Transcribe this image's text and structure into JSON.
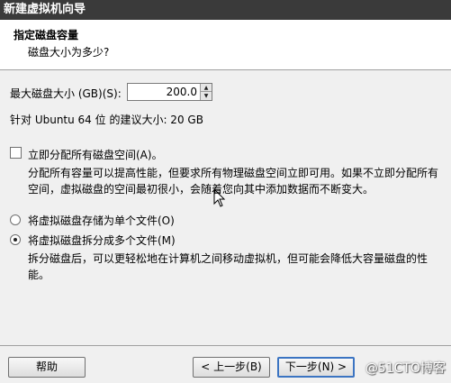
{
  "window": {
    "title": "新建虚拟机向导"
  },
  "header": {
    "title": "指定磁盘容量",
    "subtitle": "磁盘大小为多少?"
  },
  "disk": {
    "size_label": "最大磁盘大小 (GB)(S):",
    "size_value": "200.0",
    "recommend": "针对 Ubuntu 64 位 的建议大小: 20 GB"
  },
  "allocate": {
    "label": "立即分配所有磁盘空间(A)。",
    "checked": false,
    "description": "分配所有容量可以提高性能，但要求所有物理磁盘空间立即可用。如果不立即分配所有空间，虚拟磁盘的空间最初很小，会随着您向其中添加数据而不断变大。"
  },
  "storage": {
    "single_label": "将虚拟磁盘存储为单个文件(O)",
    "split_label": "将虚拟磁盘拆分成多个文件(M)",
    "selected": "split",
    "split_description": "拆分磁盘后，可以更轻松地在计算机之间移动虚拟机，但可能会降低大容量磁盘的性能。"
  },
  "buttons": {
    "help": "帮助",
    "back": "< 上一步(B)",
    "next": "下一步(N) >"
  },
  "watermark": "@51CTO博客",
  "icons": {
    "spin_up": "up-arrow-icon",
    "spin_down": "down-arrow-icon",
    "cursor": "mouse-pointer-icon"
  }
}
